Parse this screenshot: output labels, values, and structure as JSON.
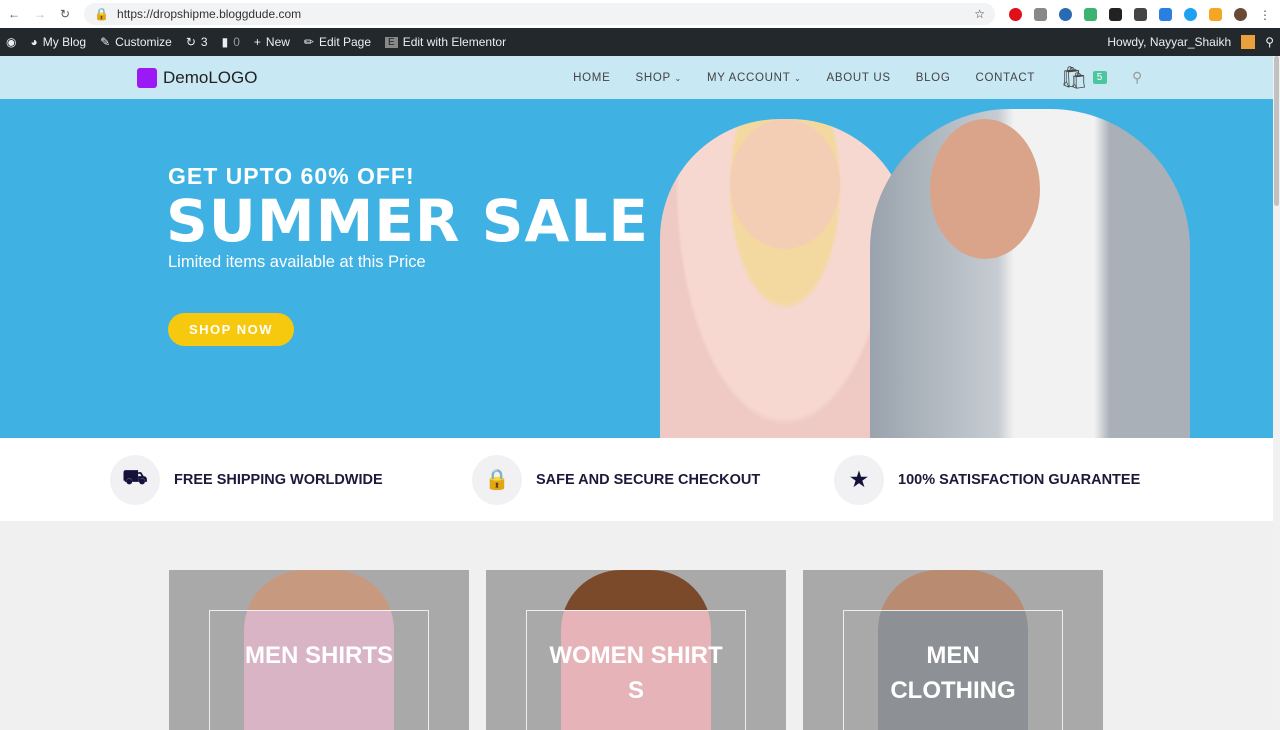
{
  "browser": {
    "url": "https://dropshipme.bloggdude.com",
    "back_icon": "arrow-left",
    "forward_icon": "arrow-right",
    "reload_icon": "reload",
    "star_icon": "star"
  },
  "admin_bar": {
    "items": [
      "My Blog",
      "Customize",
      "3",
      "0",
      "New",
      "Edit Page",
      "Edit with Elementor"
    ],
    "howdy": "Howdy, Nayyar_Shaikh"
  },
  "nav": {
    "logo": "DemoLOGO",
    "menu": [
      "HOME",
      "SHOP",
      "MY ACCOUNT",
      "ABOUT US",
      "BLOG",
      "CONTACT"
    ],
    "cart_count": "5",
    "accent": "#4dc6a0"
  },
  "hero": {
    "kicker": "GET UPTO 60% OFF!",
    "title": "SUMMER SALE",
    "subtitle": "Limited items available at this Price",
    "cta": "SHOP NOW",
    "bg": "#3fb2e3",
    "cta_color": "#f6c90e"
  },
  "features": [
    {
      "icon": "truck-icon",
      "label": "FREE SHIPPING WORLDWIDE"
    },
    {
      "icon": "lock-icon",
      "label": "SAFE AND SECURE CHECKOUT"
    },
    {
      "icon": "star-icon",
      "label": "100% SATISFACTION GUARANTEE"
    }
  ],
  "categories": [
    {
      "line1": "MEN SHIRTS",
      "line2": ""
    },
    {
      "line1": "WOMEN SHIRT",
      "line2": "S"
    },
    {
      "line1": "MEN",
      "line2": "CLOTHING"
    }
  ]
}
